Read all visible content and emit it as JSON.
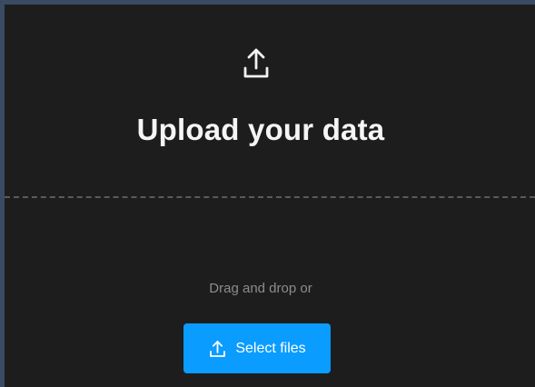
{
  "upload": {
    "icon": "upload-icon",
    "title": "Upload your data",
    "drag_text": "Drag and drop or",
    "select_button_label": "Select files",
    "button_icon": "upload-icon"
  },
  "colors": {
    "background": "#1d1d1d",
    "window_border": "#3b4a63",
    "title_text": "#f5f5f5",
    "muted_text": "#8c8c8c",
    "accent": "#0a9cff",
    "divider": "#5a5a5a"
  }
}
